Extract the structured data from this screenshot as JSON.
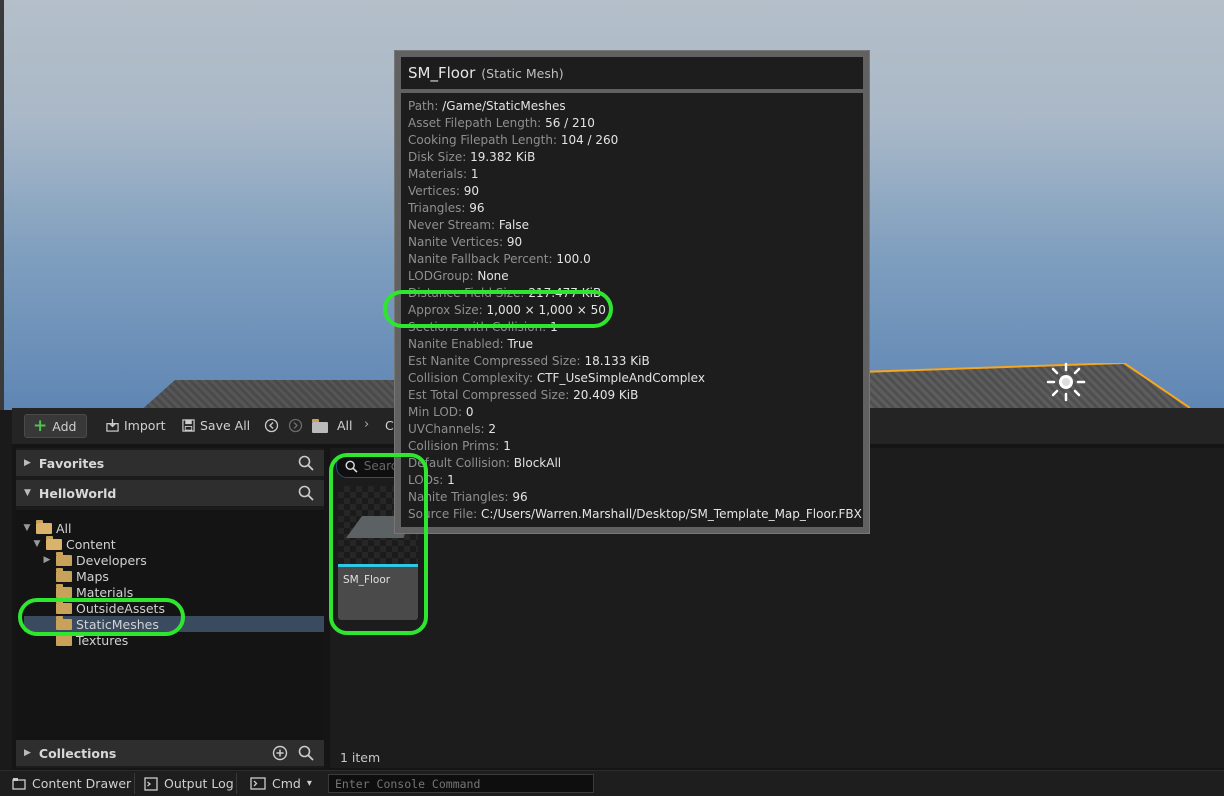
{
  "content_browser": {
    "toolbar": {
      "add_label": "Add",
      "import_label": "Import",
      "save_all_label": "Save All",
      "breadcrumb_all": "All",
      "breadcrumb_next": "C"
    },
    "sections": {
      "favorites": "Favorites",
      "project": "HelloWorld",
      "collections": "Collections"
    },
    "tree": [
      {
        "label": "All"
      },
      {
        "label": "Content"
      },
      {
        "label": "Developers"
      },
      {
        "label": "Maps"
      },
      {
        "label": "Materials"
      },
      {
        "label": "OutsideAssets"
      },
      {
        "label": "StaticMeshes"
      },
      {
        "label": "Textures"
      }
    ],
    "search_placeholder": "Search",
    "asset": {
      "name": "SM_Floor"
    },
    "item_count": "1 item"
  },
  "status_bar": {
    "content_drawer": "Content Drawer",
    "output_log": "Output Log",
    "cmd": "Cmd",
    "console_placeholder": "Enter Console Command"
  },
  "tooltip": {
    "title": "SM_Floor",
    "type": "(Static Mesh)",
    "properties": [
      {
        "key": "Path:",
        "value": "/Game/StaticMeshes"
      },
      {
        "key": "Asset Filepath Length:",
        "value": "56 / 210"
      },
      {
        "key": "Cooking Filepath Length:",
        "value": "104 / 260"
      },
      {
        "key": "Disk Size:",
        "value": "19.382 KiB"
      },
      {
        "key": "Materials:",
        "value": "1"
      },
      {
        "key": "Vertices:",
        "value": "90"
      },
      {
        "key": "Triangles:",
        "value": "96"
      },
      {
        "key": "Never Stream:",
        "value": "False"
      },
      {
        "key": "Nanite Vertices:",
        "value": "90"
      },
      {
        "key": "Nanite Fallback Percent:",
        "value": "100.0"
      },
      {
        "key": "LODGroup:",
        "value": "None"
      },
      {
        "key": "Distance Field Size:",
        "value": "217.477 KiB"
      },
      {
        "key": "Approx Size:",
        "value": "1,000 × 1,000 × 50"
      },
      {
        "key": "Sections with Collision:",
        "value": "1"
      },
      {
        "key": "Nanite Enabled:",
        "value": "True"
      },
      {
        "key": "Est Nanite Compressed Size:",
        "value": "18.133 KiB"
      },
      {
        "key": "Collision Complexity:",
        "value": "CTF_UseSimpleAndComplex"
      },
      {
        "key": "Est Total Compressed Size:",
        "value": "20.409 KiB"
      },
      {
        "key": "Min LOD:",
        "value": "0"
      },
      {
        "key": "UVChannels:",
        "value": "2"
      },
      {
        "key": "Collision Prims:",
        "value": "1"
      },
      {
        "key": "Default Collision:",
        "value": "BlockAll"
      },
      {
        "key": "LODs:",
        "value": "1"
      },
      {
        "key": "Nanite Triangles:",
        "value": "96"
      },
      {
        "key": "Source File:",
        "value": "C:/Users/Warren.Marshall/Desktop/SM_Template_Map_Floor.FBX"
      }
    ]
  },
  "icons": {
    "add": "plus-icon",
    "import": "import-icon",
    "save_all": "save-icon",
    "history": "history-icon",
    "forward": "forward-icon",
    "folder": "folder-icon",
    "search": "search-icon",
    "add_collection": "add-circle-icon",
    "light": "light-source-icon"
  },
  "colors": {
    "highlight": "#2fe62f",
    "add_plus": "#4fc24f",
    "asset_bar": "#32c6e6",
    "selection": "#3a4a5f",
    "folder": "#c8a25a",
    "selected_outline": "#f5a623"
  }
}
